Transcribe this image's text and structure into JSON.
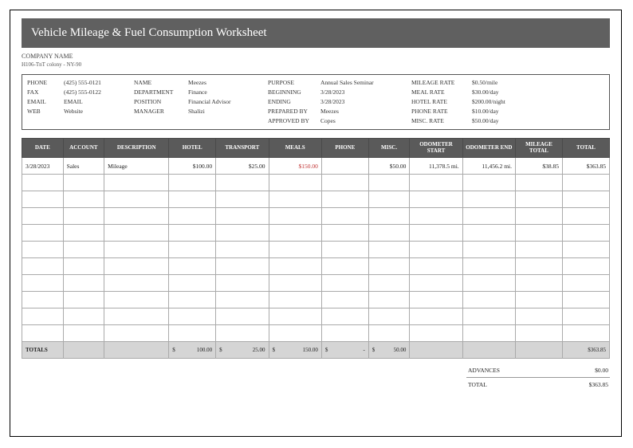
{
  "title": "Vehicle Mileage & Fuel Consumption Worksheet",
  "company_name": "COMPANY NAME",
  "address": "H106-TnT colony - NY-90",
  "info": {
    "phone_label": "PHONE",
    "phone": "(425) 555-0121",
    "fax_label": "FAX",
    "fax": "(425) 555-0122",
    "email_label": "EMAIL",
    "email": "EMAIL",
    "web_label": "WEB",
    "web": "Website",
    "name_label": "NAME",
    "name": "Meezes",
    "dept_label": "DEPARTMENT",
    "dept": "Finance",
    "pos_label": "POSITION",
    "pos": "Financial Advisor",
    "mgr_label": "MANAGER",
    "mgr": "Shalizi",
    "purpose_label": "PURPOSE",
    "purpose": "Annual Sales Seminar",
    "begin_label": "BEGINNING",
    "begin": "3/28/2023",
    "end_label": "ENDING",
    "end": "3/28/2023",
    "prep_label": "PREPARED BY",
    "prep": "Meezes",
    "appr_label": "APPROVED BY",
    "appr": "Copes",
    "mileage_label": "MILEAGE RATE",
    "mileage_rate": "$0.50/mile",
    "meal_label": "MEAL RATE",
    "meal_rate": "$30.00/day",
    "hotelr_label": "HOTEL RATE",
    "hotel_rate": "$200.00/night",
    "phoner_label": "PHONE RATE",
    "phone_rate": "$10.00/day",
    "misc_label": "MISC. RATE",
    "misc_rate": "$50.00/day"
  },
  "columns": [
    "DATE",
    "ACCOUNT",
    "DESCRIPTION",
    "HOTEL",
    "TRANSPORT",
    "MEALS",
    "PHONE",
    "MISC.",
    "ODOMETER START",
    "ODOMETER END",
    "MILEAGE TOTAL",
    "TOTAL"
  ],
  "row": {
    "date": "3/28/2023",
    "account": "Sales",
    "desc": "Mileage",
    "hotel": "$100.00",
    "transport": "$25.00",
    "meals": "$150.00",
    "phone": "",
    "misc": "$50.00",
    "ostart": "11,378.5 mi.",
    "oend": "11,456.2 mi.",
    "mtot": "$38.85",
    "total": "$363.85"
  },
  "totals_label": "TOTALS",
  "totals": {
    "hotel_sym": "$",
    "hotel": "100.00",
    "trans_sym": "$",
    "trans": "25.00",
    "meals_sym": "$",
    "meals": "150.00",
    "phone_sym": "$",
    "phone": "-",
    "misc_sym": "$",
    "misc": "50.00",
    "total": "$363.85"
  },
  "footer": {
    "advances_label": "ADVANCES",
    "advances": "$0.00",
    "total_label": "TOTAL",
    "total": "$363.85"
  }
}
